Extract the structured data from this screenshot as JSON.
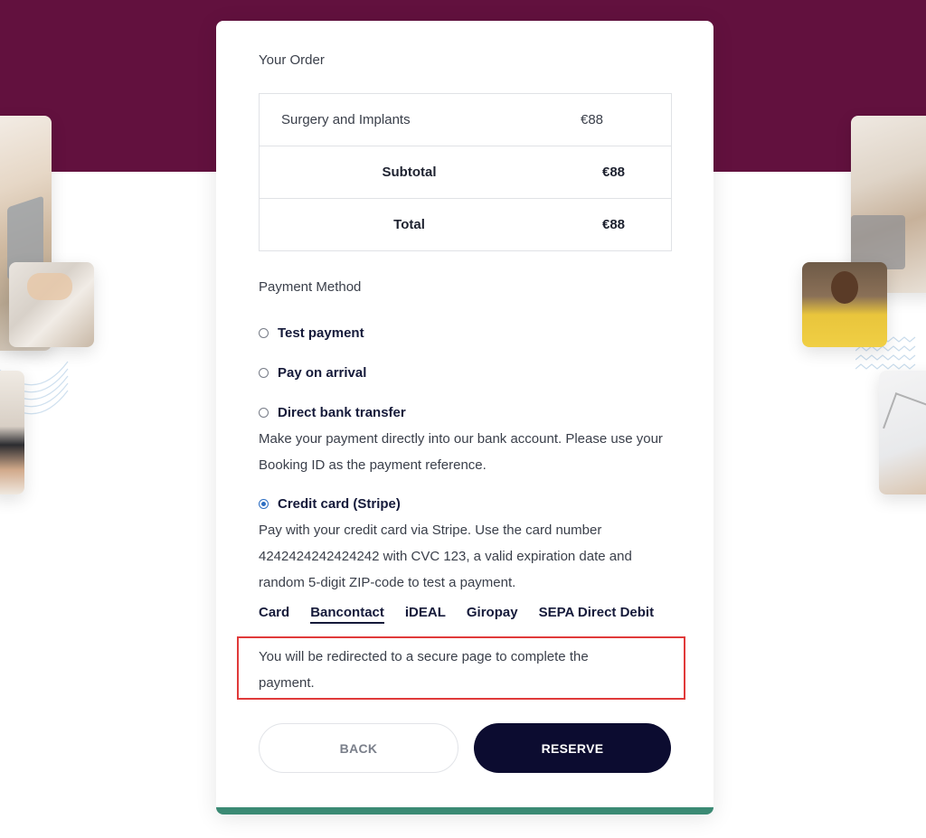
{
  "order": {
    "title": "Your Order",
    "items": [
      {
        "name": "Surgery and Implants",
        "amount": "€88"
      }
    ],
    "subtotal_label": "Subtotal",
    "subtotal_value": "€88",
    "total_label": "Total",
    "total_value": "€88"
  },
  "payment": {
    "title": "Payment Method",
    "options": [
      {
        "label": "Test payment",
        "checked": false
      },
      {
        "label": "Pay on arrival",
        "checked": false
      },
      {
        "label": "Direct bank transfer",
        "checked": false
      },
      {
        "label": "Credit card (Stripe)",
        "checked": true
      }
    ],
    "bank_description": "Make your payment directly into our bank account. Please use your Booking ID as the payment reference.",
    "card_description": "Pay with your credit card via Stripe. Use the card number 4242424242424242 with CVC 123, a valid expiration date and random 5-digit ZIP-code to test a payment.",
    "stripe_tabs": [
      "Card",
      "Bancontact",
      "iDEAL",
      "Giropay",
      "SEPA Direct Debit"
    ],
    "active_tab": "Bancontact",
    "redirect_notice": "You will be redirected to a secure page to complete the payment."
  },
  "actions": {
    "back_label": "BACK",
    "reserve_label": "RESERVE"
  },
  "colors": {
    "header_band": "#62113e",
    "accent_bottom": "#3b8a74",
    "primary_button": "#0c0c30",
    "highlight_border": "#e03a3a",
    "radio_checked": "#2d6ec2"
  }
}
